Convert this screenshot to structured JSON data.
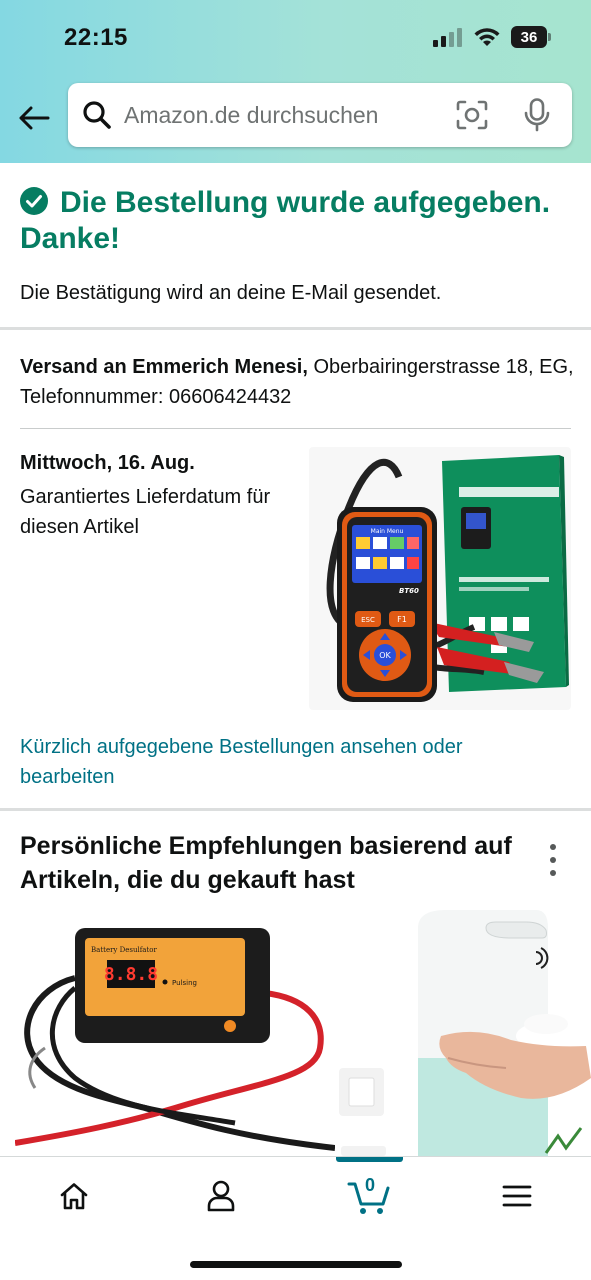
{
  "status_bar": {
    "time": "22:15",
    "battery": "36"
  },
  "search": {
    "placeholder": "Amazon.de durchsuchen"
  },
  "order": {
    "success_title": "Die Bestellung wurde aufgegeben. Danke!",
    "confirmation": "Die Bestätigung wird an deine E-Mail gesendet.",
    "shipping_label": "Versand an Emmerich Menesi,",
    "shipping_address": "Oberbairingerstrasse 18, EG, Telefonnummer: 06606424432",
    "delivery_date": "Mittwoch, 16. Aug.",
    "delivery_note": "Garantiertes Lieferdatum für diesen Artikel",
    "product_image_text": {
      "screen_title": "Main Menu",
      "model": "BT60",
      "esc": "ESC",
      "f1": "F1",
      "ok": "OK"
    }
  },
  "orders_link": "Kürzlich aufgegebene Bestellungen ansehen oder bearbeiten",
  "recommendations": {
    "title": "Persönliche Empfehlungen basierend auf Artikeln, die du gekauft hast",
    "items": [
      {
        "icon": "battery-desulfator-image",
        "label": "Battery Desulfator",
        "display": "8.8.8",
        "status": "Pulsing"
      },
      {
        "icon": "soap-dispenser-image"
      }
    ]
  },
  "bottom_nav": {
    "items": [
      {
        "icon": "home-icon"
      },
      {
        "icon": "account-icon"
      },
      {
        "icon": "cart-icon",
        "count": "0"
      },
      {
        "icon": "menu-icon"
      }
    ]
  },
  "colors": {
    "success": "#067d62",
    "link": "#007185",
    "accent": "#ff9900"
  }
}
